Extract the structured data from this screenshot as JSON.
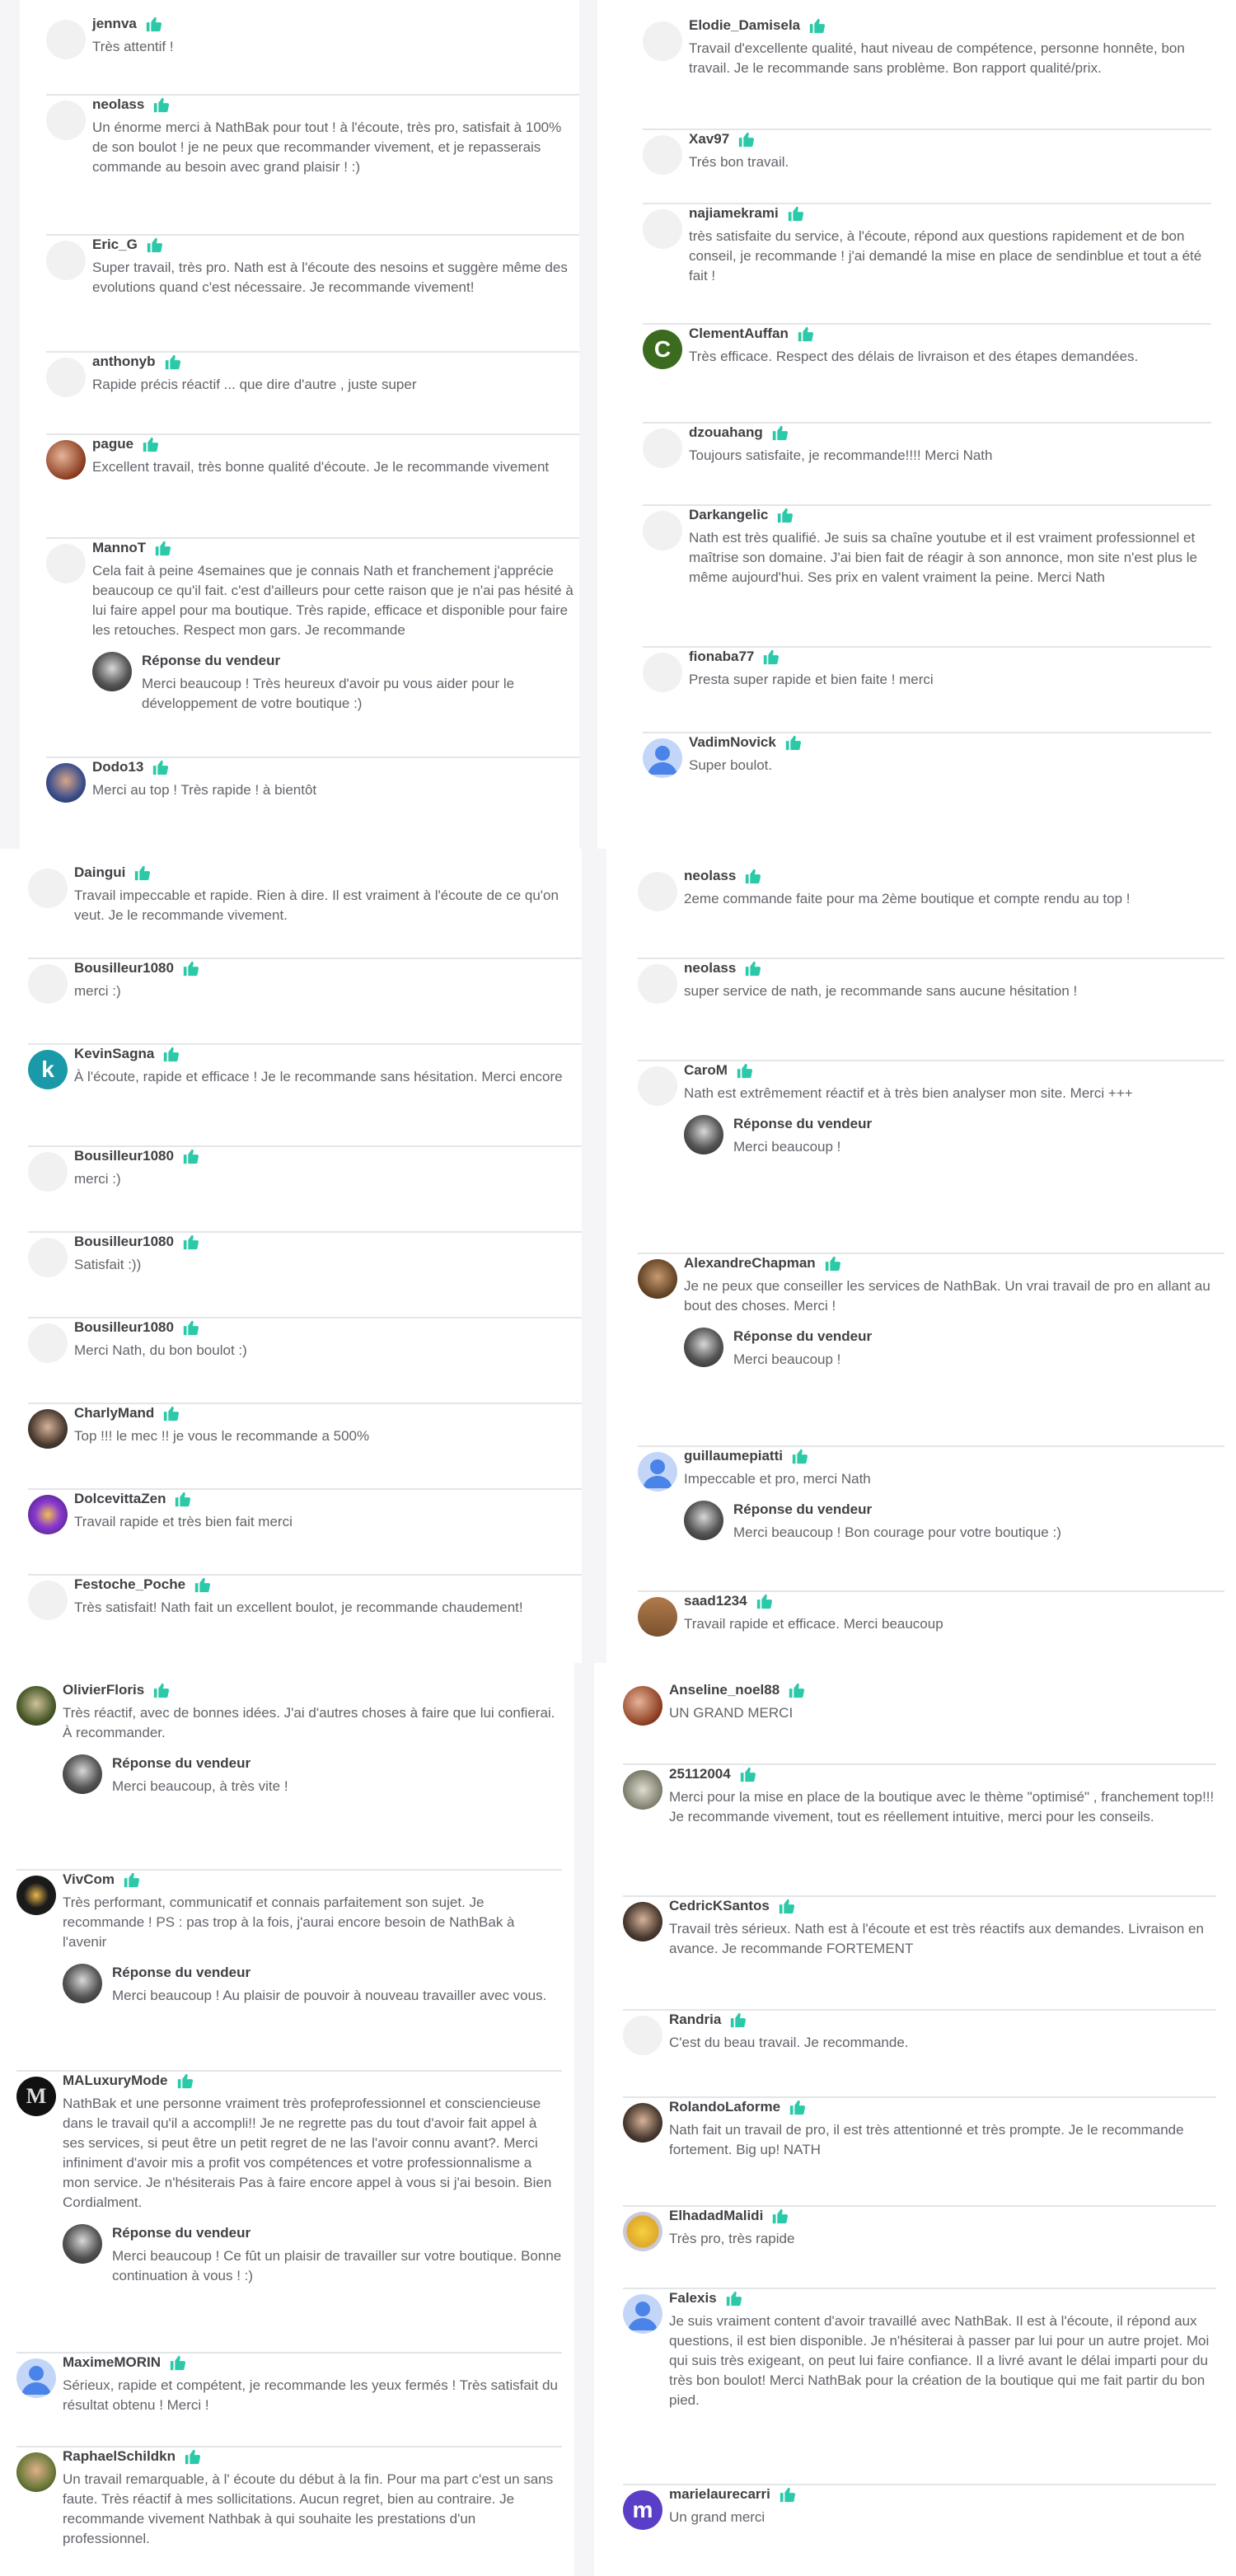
{
  "panels": [
    {
      "id": "top-left",
      "reviews": [
        {
          "name": "jennva",
          "avatar": "blank",
          "text": "Très attentif !"
        },
        {
          "name": "neolass",
          "avatar": "blank",
          "text": "Un énorme merci à NathBak pour tout ! à l'écoute, très pro, satisfait à 100% de son boulot ! je ne peux que recommander vivement, et je repasserais commande au besoin avec grand plaisir ! :)"
        },
        {
          "name": "Eric_G",
          "avatar": "blank",
          "text": "Super travail, très pro. Nath est à l'écoute des nesoins et suggère même des evolutions quand c'est nécessaire. Je recommande vivement!"
        },
        {
          "name": "anthonyb",
          "avatar": "blank",
          "text": "Rapide précis réactif ... que dire d'autre , juste super"
        },
        {
          "name": "pague",
          "avatar": "photo-red",
          "text": "Excellent travail, très bonne qualité d'écoute. Je le recommande vivement"
        },
        {
          "name": "MannoT",
          "avatar": "blank",
          "text": "Cela fait à peine 4semaines que je connais Nath et franchement j'apprécie beaucoup ce qu'il fait. c'est d'ailleurs pour cette raison que je n'ai pas hésité à lui faire appel pour ma boutique. Très rapide, efficace et disponible pour faire les retouches. Respect mon gars. Je recommande",
          "reply": {
            "label": "Réponse du vendeur",
            "text": "Merci beaucoup ! Très heureux d'avoir pu vous aider pour le développement de votre boutique :)"
          }
        },
        {
          "name": "Dodo13",
          "avatar": "photo-blue",
          "text": "Merci au top ! Très rapide ! à bientôt"
        }
      ]
    },
    {
      "id": "top-right",
      "reviews": [
        {
          "name": "Elodie_Damisela",
          "avatar": "blank",
          "text": "Travail d'excellente qualité, haut niveau de compétence, personne honnête, bon travail. Je le recommande sans problème. Bon rapport qualité/prix."
        },
        {
          "name": "Xav97",
          "avatar": "blank",
          "text": "Trés bon travail."
        },
        {
          "name": "najiamekrami",
          "avatar": "blank",
          "text": "très satisfaite du service, à l'écoute, répond aux questions rapidement et de bon conseil, je recommande ! j'ai demandé la mise en place de sendinblue et tout a été fait !"
        },
        {
          "name": "ClementAuffan",
          "avatar": "letter",
          "letter": "C",
          "color": "#3a6b1f",
          "text": "Très efficace. Respect des délais de livraison et des étapes demandées."
        },
        {
          "name": "dzouahang",
          "avatar": "blank",
          "text": "Toujours satisfaite, je recommande!!!! Merci Nath"
        },
        {
          "name": "Darkangelic",
          "avatar": "blank",
          "text": "Nath est très qualifié. Je suis sa chaîne youtube et il est vraiment professionnel et maîtrise son domaine. J'ai bien fait de réagir à son annonce, mon site n'est plus le même aujourd'hui. Ses prix en valent vraiment la peine. Merci Nath"
        },
        {
          "name": "fionaba77",
          "avatar": "blank",
          "text": "Presta super rapide et bien faite ! merci"
        },
        {
          "name": "VadimNovick",
          "avatar": "person",
          "text": "Super boulot."
        }
      ]
    },
    {
      "id": "middle-left",
      "reviews": [
        {
          "name": "Daingui",
          "avatar": "blank",
          "text": "Travail impeccable et rapide. Rien à dire. Il est vraiment à l'écoute de ce qu'on veut. Je le recommande vivement."
        },
        {
          "name": "Bousilleur1080",
          "avatar": "blank",
          "text": "merci :)"
        },
        {
          "name": "KevinSagna",
          "avatar": "letter",
          "letter": "k",
          "color": "#1a9aa8",
          "text": "À l'écoute, rapide et efficace ! Je le recommande sans hésitation. Merci encore"
        },
        {
          "name": "Bousilleur1080",
          "avatar": "blank",
          "text": "merci :)"
        },
        {
          "name": "Bousilleur1080",
          "avatar": "blank",
          "text": "Satisfait :))"
        },
        {
          "name": "Bousilleur1080",
          "avatar": "blank",
          "text": "Merci Nath, du bon boulot :)"
        },
        {
          "name": "CharlyMand",
          "avatar": "photo-dark",
          "text": "Top !!! le mec !! je vous le recommande a 500%"
        },
        {
          "name": "DolcevittaZen",
          "avatar": "photo-purple",
          "text": "Travail rapide et très bien fait merci"
        },
        {
          "name": "Festoche_Poche",
          "avatar": "blank",
          "text": "Très satisfait! Nath fait un excellent boulot, je recommande chaudement!"
        }
      ]
    },
    {
      "id": "middle-right",
      "reviews": [
        {
          "name": "neolass",
          "avatar": "blank",
          "text": "2eme commande faite pour ma 2ème boutique et compte rendu au top !"
        },
        {
          "name": "neolass",
          "avatar": "blank",
          "text": "super service de nath, je recommande sans aucune hésitation !"
        },
        {
          "name": "CaroM",
          "avatar": "blank",
          "text": "Nath est extrêmement réactif et à très bien analyser mon site. Merci +++",
          "reply": {
            "label": "Réponse du vendeur",
            "text": "Merci beaucoup !"
          }
        },
        {
          "name": "AlexandreChapman",
          "avatar": "photo-brown",
          "text": "Je ne peux que conseiller les services de NathBak. Un vrai travail de pro en allant au bout des choses. Merci !",
          "reply": {
            "label": "Réponse du vendeur",
            "text": "Merci beaucoup !"
          }
        },
        {
          "name": "guillaumepiatti",
          "avatar": "person",
          "text": "Impeccable et pro, merci Nath",
          "reply": {
            "label": "Réponse du vendeur",
            "text": "Merci beaucoup ! Bon courage pour votre boutique :)"
          }
        },
        {
          "name": "saad1234",
          "avatar": "photo-laptop",
          "text": "Travail rapide et efficace. Merci beaucoup"
        }
      ]
    },
    {
      "id": "bottom-left",
      "reviews": [
        {
          "name": "OlivierFloris",
          "avatar": "photo-green",
          "text": "Très réactif, avec de bonnes idées. J'ai d'autres choses à faire que lui confierai. À recommander.",
          "reply": {
            "label": "Réponse du vendeur",
            "text": "Merci beaucoup, à très vite !"
          }
        },
        {
          "name": "VivCom",
          "avatar": "photo-black",
          "text": "Très performant, communicatif et connais parfaitement son sujet. Je recommande ! PS : pas trop à la fois, j'aurai encore besoin de NathBak à l'avenir",
          "reply": {
            "label": "Réponse du vendeur",
            "text": "Merci beaucoup ! Au plaisir de pouvoir à nouveau travailler avec vous."
          }
        },
        {
          "name": "MALuxuryMode",
          "avatar": "photo-logo",
          "text": "NathBak et une personne vraiment très profeprofessionnel et consciencieuse dans le travail qu'il a accompli!! Je ne regrette pas du tout d'avoir fait appel à ses services, si peut être un petit regret de ne las l'avoir connu avant?. Merci infiniment d'avoir mis a profit vos compétences et votre professionnalisme a mon service. Je n'hésiterais Pas à faire encore appel à vous si j'ai besoin. Bien Cordialment.",
          "reply": {
            "label": "Réponse du vendeur",
            "text": "Merci beaucoup ! Ce fût un plaisir de travailler sur votre boutique. Bonne continuation à vous ! :)"
          }
        },
        {
          "name": "MaximeMORIN",
          "avatar": "person",
          "text": "Sérieux, rapide et compétent, je recommande les yeux fermés ! Très satisfait du résultat obtenu ! Merci !"
        },
        {
          "name": "RaphaelSchildkn",
          "avatar": "photo-olive",
          "text": "Un travail remarquable, à l' écoute du début à la fin. Pour ma part c'est un sans faute. Très réactif à mes sollicitations. Aucun regret, bien au contraire. Je recommande vivement Nathbak à qui souhaite les prestations d'un professionnel."
        }
      ]
    },
    {
      "id": "bottom-right",
      "reviews": [
        {
          "name": "Anseline_noel88",
          "avatar": "photo-red",
          "text": "UN GRAND MERCI"
        },
        {
          "name": "25112004",
          "avatar": "photo-grey",
          "text": "Merci pour la mise en place de la boutique avec le thème \"optimisé\" , franchement top!!! Je recommande vivement, tout es réellement intuitive, merci pour les conseils."
        },
        {
          "name": "CedricKSantos",
          "avatar": "photo-dark",
          "text": "Travail très sérieux. Nath est à l'écoute et est très réactifs aux demandes. Livraison en avance. Je recommande FORTEMENT"
        },
        {
          "name": "Randria",
          "avatar": "blank",
          "text": "C'est du beau travail. Je recommande."
        },
        {
          "name": "RolandoLaforme",
          "avatar": "photo-dark",
          "text": "Nath fait un travail de pro, il est très attentionné et très prompte. Je le recommande fortement. Big up! NATH"
        },
        {
          "name": "ElhadadMalidi",
          "avatar": "photo-lego",
          "text": "Très pro, très rapide"
        },
        {
          "name": "Falexis",
          "avatar": "person",
          "text": "Je suis vraiment content d'avoir travaillé avec NathBak. Il est à l'écoute, il répond aux questions, il est bien disponible. Je n'hésiterai à passer par lui pour un autre projet. Moi qui suis très exigeant, on peut lui faire confiance. Il a livré avant le délai imparti pour du très bon boulot! Merci NathBak pour la création de la boutique qui me fait partir du bon pied."
        },
        {
          "name": "marielaurecarri",
          "avatar": "letter",
          "letter": "m",
          "color": "#5b3ec8",
          "text": "Un grand merci"
        }
      ]
    }
  ],
  "colors": {
    "thumb": "#2bc9a8",
    "text": "#62646a",
    "name": "#404145",
    "divider": "#e4e5e7"
  }
}
